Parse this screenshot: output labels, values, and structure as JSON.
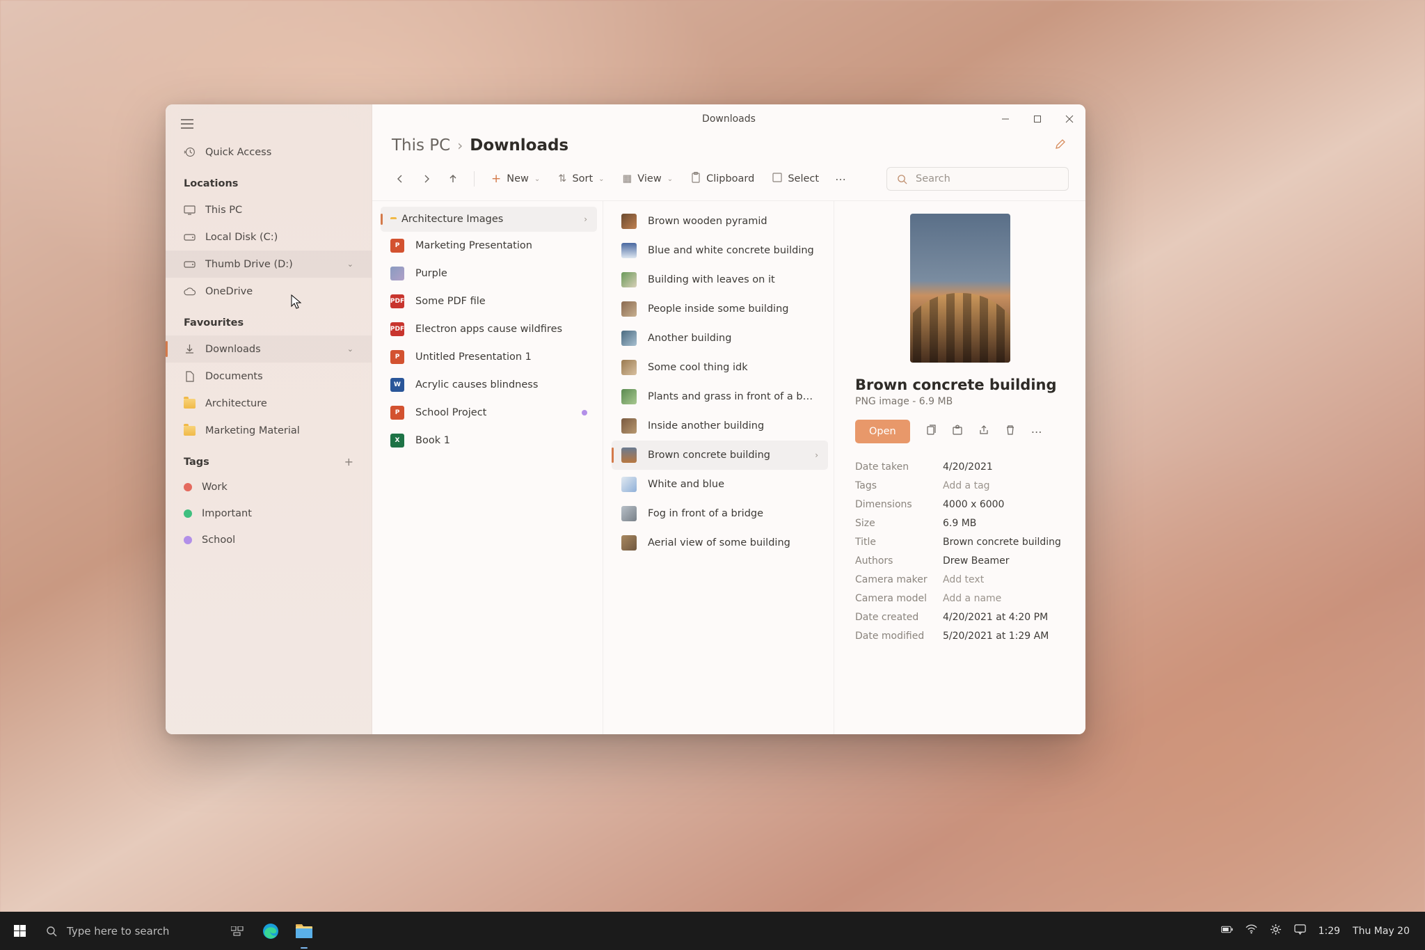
{
  "window": {
    "title": "Downloads",
    "breadcrumb": {
      "root": "This PC",
      "current": "Downloads"
    }
  },
  "sidebar": {
    "quick_access": "Quick Access",
    "locations_label": "Locations",
    "locations": [
      {
        "label": "This PC",
        "icon": "monitor"
      },
      {
        "label": "Local Disk (C:)",
        "icon": "drive"
      },
      {
        "label": "Thumb Drive (D:)",
        "icon": "drive",
        "hovered": true,
        "expandable": true
      },
      {
        "label": "OneDrive",
        "icon": "cloud"
      }
    ],
    "favourites_label": "Favourites",
    "favourites": [
      {
        "label": "Downloads",
        "icon": "download",
        "selected": true,
        "expandable": true
      },
      {
        "label": "Documents",
        "icon": "document"
      },
      {
        "label": "Architecture",
        "icon": "folder"
      },
      {
        "label": "Marketing Material",
        "icon": "folder"
      }
    ],
    "tags_label": "Tags",
    "tags": [
      {
        "label": "Work",
        "color": "#e46a5e"
      },
      {
        "label": "Important",
        "color": "#3fbf7f"
      },
      {
        "label": "School",
        "color": "#b28fe8"
      }
    ]
  },
  "toolbar": {
    "new": "New",
    "sort": "Sort",
    "view": "View",
    "clipboard": "Clipboard",
    "select": "Select",
    "search_placeholder": "Search"
  },
  "column1": [
    {
      "label": "Architecture Images",
      "type": "folder",
      "selected": true,
      "chevron": true
    },
    {
      "label": "Marketing Presentation",
      "type": "ppt"
    },
    {
      "label": "Purple",
      "type": "img"
    },
    {
      "label": "Some PDF file",
      "type": "pdf"
    },
    {
      "label": "Electron apps cause wildfires",
      "type": "pdf"
    },
    {
      "label": "Untitled Presentation 1",
      "type": "ppt"
    },
    {
      "label": "Acrylic causes blindness",
      "type": "word"
    },
    {
      "label": "School Project",
      "type": "ppt",
      "dot": true
    },
    {
      "label": "Book 1",
      "type": "xls"
    }
  ],
  "column2": [
    {
      "label": "Brown wooden pyramid",
      "thumb": "linear-gradient(135deg,#6a4a30,#c08050)"
    },
    {
      "label": "Blue and white concrete building",
      "thumb": "linear-gradient(180deg,#4a68a0,#dde6f0)"
    },
    {
      "label": "Building with leaves on it",
      "thumb": "linear-gradient(135deg,#6a9a5a,#d8d0b8)"
    },
    {
      "label": "People inside some building",
      "thumb": "linear-gradient(135deg,#8a6a50,#c8b090)"
    },
    {
      "label": "Another building",
      "thumb": "linear-gradient(135deg,#4a6a80,#a8c0d0)"
    },
    {
      "label": "Some cool thing idk",
      "thumb": "linear-gradient(135deg,#9a7a50,#d8c0a0)"
    },
    {
      "label": "Plants and grass in front of a building",
      "thumb": "linear-gradient(135deg,#5a8a50,#a8c890)"
    },
    {
      "label": "Inside another building",
      "thumb": "linear-gradient(135deg,#7a5a40,#b89870)"
    },
    {
      "label": "Brown concrete building",
      "thumb": "linear-gradient(180deg,#6a7a90,#b87840)",
      "selected": true,
      "chevron": true
    },
    {
      "label": "White and blue",
      "thumb": "linear-gradient(135deg,#e0e8f0,#90b0d8)"
    },
    {
      "label": "Fog in front of a bridge",
      "thumb": "linear-gradient(135deg,#b8c0c8,#788088)"
    },
    {
      "label": "Aerial view of some building",
      "thumb": "linear-gradient(135deg,#a88860,#705840)"
    }
  ],
  "details": {
    "title": "Brown concrete building",
    "subtitle": "PNG image - 6.9 MB",
    "open": "Open",
    "meta": [
      {
        "k": "Date taken",
        "v": "4/20/2021"
      },
      {
        "k": "Tags",
        "v": "Add a tag",
        "placeholder": true
      },
      {
        "k": "Dimensions",
        "v": "4000 x 6000"
      },
      {
        "k": "Size",
        "v": "6.9 MB"
      },
      {
        "k": "Title",
        "v": "Brown concrete building"
      },
      {
        "k": "Authors",
        "v": "Drew Beamer"
      },
      {
        "k": "Camera maker",
        "v": "Add text",
        "placeholder": true
      },
      {
        "k": "Camera model",
        "v": "Add a name",
        "placeholder": true
      },
      {
        "k": "Date created",
        "v": "4/20/2021 at 4:20 PM"
      },
      {
        "k": "Date modified",
        "v": "5/20/2021 at 1:29 AM"
      }
    ]
  },
  "taskbar": {
    "search_placeholder": "Type here to search",
    "time": "1:29",
    "date": "Thu May 20"
  }
}
